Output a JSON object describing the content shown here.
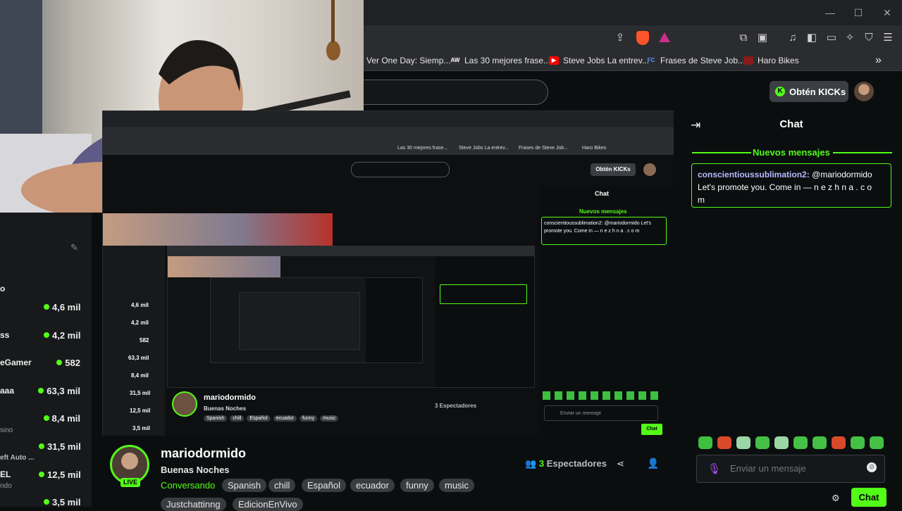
{
  "browser": {
    "window_controls": [
      "—",
      "☐",
      "✕"
    ],
    "bookmarks": [
      {
        "label": "Ver One Day: Siemp...",
        "icon": ""
      },
      {
        "label": "Las 30 mejores frase...",
        "icon": "AW"
      },
      {
        "label": "Steve Jobs La entrev...",
        "icon": "▶"
      },
      {
        "label": "Frases de Steve Job...",
        "icon": "FC"
      },
      {
        "label": "Haro Bikes",
        "icon": ""
      }
    ],
    "bookmarks_more": "»"
  },
  "header": {
    "kicks_label": "Obtén KICKs",
    "kick_logo": "K"
  },
  "sidebar": {
    "items": [
      {
        "name": "o",
        "count": "4,6 mil"
      },
      {
        "name": "ss",
        "count": "4,2 mil"
      },
      {
        "name": "eGamer",
        "count": "582"
      },
      {
        "name": "aaa",
        "count": "63,3 mil"
      },
      {
        "name": "",
        "count": "8,4 mil"
      },
      {
        "name": "sino",
        "count": "31,5 mil"
      },
      {
        "name": "eft Auto ...",
        "count": ""
      },
      {
        "name": "EL",
        "count": "12,5 mil"
      },
      {
        "name": "ndo",
        "count": ""
      },
      {
        "name": "",
        "count": "3,5 mil"
      }
    ]
  },
  "channel": {
    "name": "mariodormido",
    "title": "Buenas Noches",
    "category": "Conversando",
    "live_label": "LIVE",
    "tags": [
      "Spanish",
      "chill",
      "Español",
      "ecuador",
      "funny",
      "music",
      "Justchattinng",
      "EdicionEnVivo"
    ],
    "viewers_count": "3",
    "viewers_label": "Espectadores"
  },
  "chat": {
    "header": "Chat",
    "new_messages_label": "Nuevos mensajes",
    "message": {
      "user": "conscientioussublimation2:",
      "text_line1": " @mariodormido",
      "text_line2": "Let's promote you. Come in  — n e z h n  a . c o",
      "text_line3": "m"
    },
    "input_placeholder": "Enviar un mensaje",
    "send_label": "Chat",
    "emote_colors": [
      "#3fbf3f",
      "#d94a2a",
      "#9ad6a6",
      "#44c046",
      "#9ad6a6",
      "#44c046",
      "#44c046",
      "#d94a2a",
      "#44c046",
      "#44c046"
    ]
  },
  "mirror": {
    "chat_header": "Chat",
    "new_messages_label": "Nuevos mensajes",
    "message": "conscientioussublimation2: @mariodormido Let's promote you. Come in  — n e z h n a . c o m",
    "kicks_label": "Obtén KICKs",
    "channel_name": "mariodormido",
    "channel_title": "Buenas Noches",
    "viewers": "3 Espectadores",
    "input_placeholder": "Enviar un mensaje",
    "send_label": "Chat",
    "sidebar_counts": [
      "4,6 mil",
      "4,2 mil",
      "582",
      "63,3 mil",
      "8,4 mil",
      "31,5 mil",
      "12,5 mil",
      "3,5 mil"
    ],
    "tags": [
      "Spanish",
      "chill",
      "Español",
      "ecuador",
      "funny",
      "music"
    ],
    "bookmarks": [
      "Las 30 mejores frase...",
      "Steve Jobs La entrev...",
      "Frases de Steve Job...",
      "Haro Bikes"
    ]
  }
}
